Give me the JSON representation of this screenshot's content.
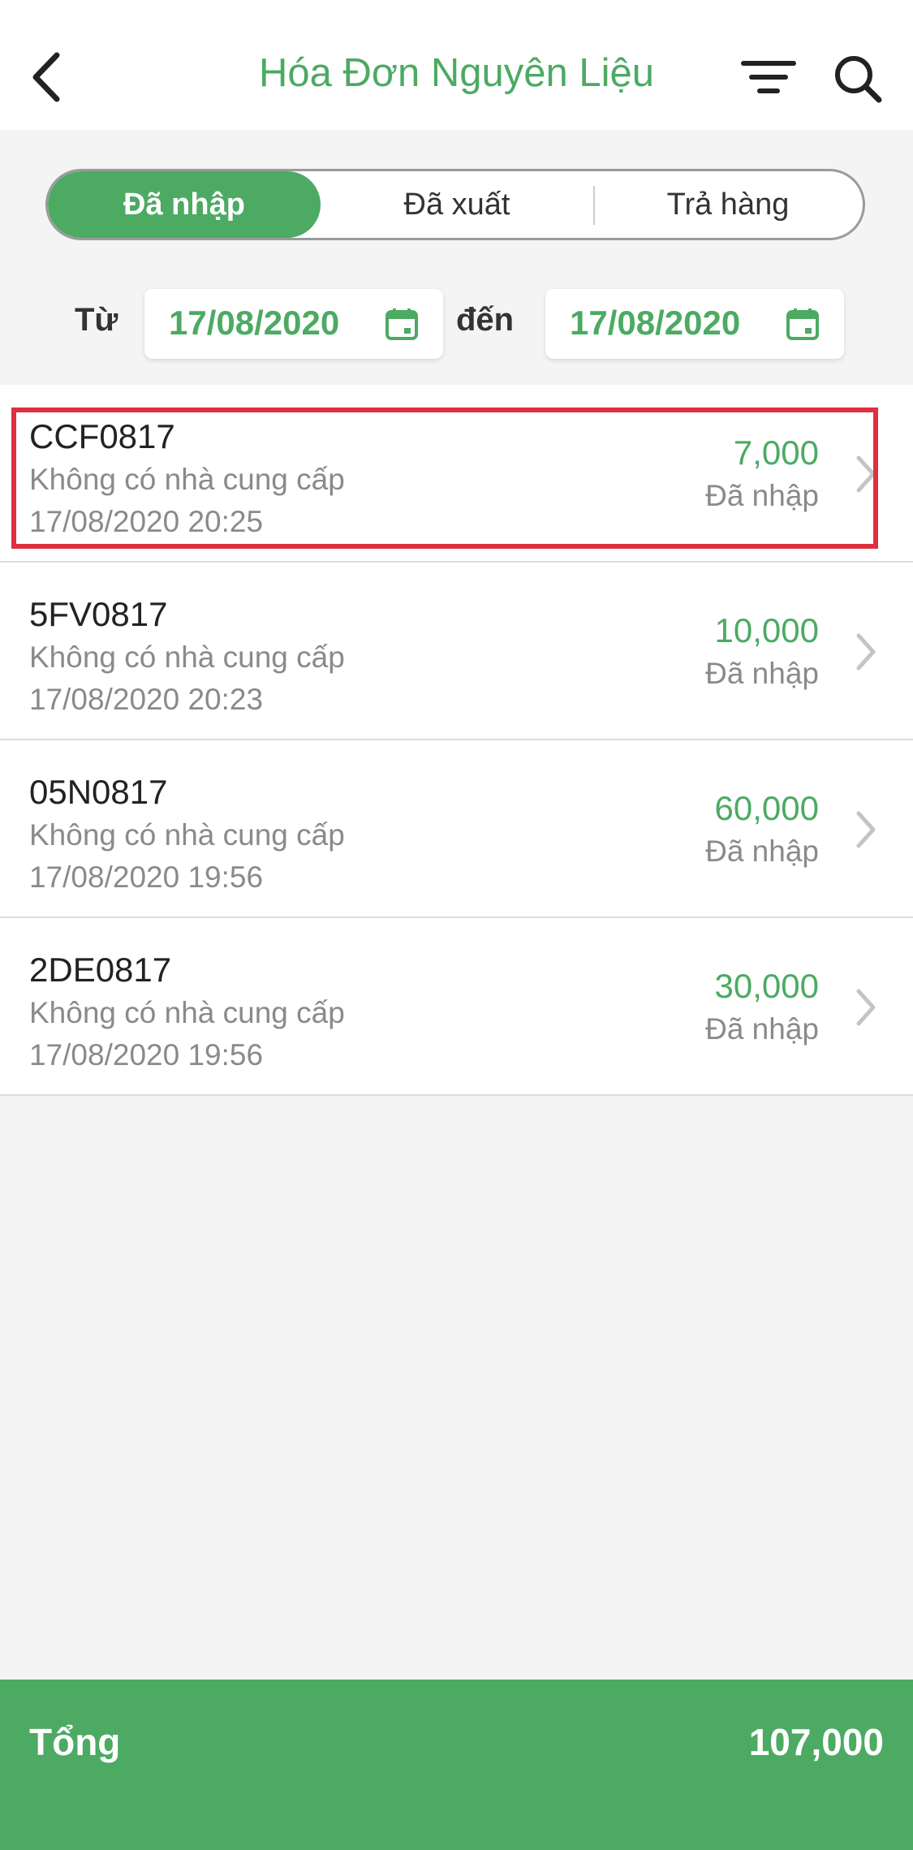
{
  "header": {
    "title": "Hóa Đơn Nguyên Liệu",
    "back_icon": "chevron-left-icon",
    "filter_icon": "filter-icon",
    "search_icon": "search-icon"
  },
  "tabs": [
    {
      "label": "Đã nhập",
      "active": true
    },
    {
      "label": "Đã xuất",
      "active": false
    },
    {
      "label": "Trả hàng",
      "active": false
    }
  ],
  "date_range": {
    "from_label": "Từ",
    "from_value": "17/08/2020",
    "to_label": "đến",
    "to_value": "17/08/2020"
  },
  "invoices": [
    {
      "code": "CCF0817",
      "supplier": "Không có nhà cung cấp",
      "datetime": "17/08/2020 20:25",
      "amount": "7,000",
      "status": "Đã nhập",
      "highlighted": true
    },
    {
      "code": "5FV0817",
      "supplier": "Không có nhà cung cấp",
      "datetime": "17/08/2020 20:23",
      "amount": "10,000",
      "status": "Đã nhập"
    },
    {
      "code": "05N0817",
      "supplier": "Không có nhà cung cấp",
      "datetime": "17/08/2020 19:56",
      "amount": "60,000",
      "status": "Đã nhập"
    },
    {
      "code": "2DE0817",
      "supplier": "Không có nhà cung cấp",
      "datetime": "17/08/2020 19:56",
      "amount": "30,000",
      "status": "Đã nhập"
    }
  ],
  "footer": {
    "total_label": "Tổng",
    "total_value": "107,000"
  },
  "colors": {
    "brand_green": "#4caa63",
    "highlight_red": "#e0303f"
  }
}
